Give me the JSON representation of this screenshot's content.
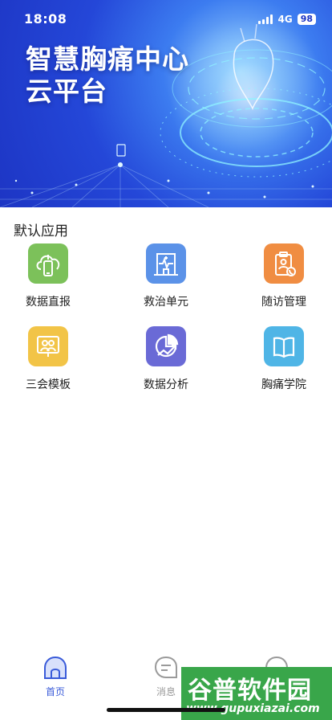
{
  "status_bar": {
    "time": "18:08",
    "network": "4G",
    "battery": "98"
  },
  "hero": {
    "title_line1": "智慧胸痛中心",
    "title_line2": "云平台"
  },
  "section": {
    "title": "默认应用"
  },
  "apps": [
    {
      "label": "数据直报",
      "icon": "cloud-phone-icon",
      "color": "#7cc15a"
    },
    {
      "label": "救治单元",
      "icon": "hospital-heartbeat-icon",
      "color": "#5b92e8"
    },
    {
      "label": "随访管理",
      "icon": "clipboard-phone-icon",
      "color": "#f08d42"
    },
    {
      "label": "三会模板",
      "icon": "meeting-people-icon",
      "color": "#f2c447"
    },
    {
      "label": "数据分析",
      "icon": "analytics-chart-icon",
      "color": "#6a6ad6"
    },
    {
      "label": "胸痛学院",
      "icon": "book-icon",
      "color": "#4fb5e6"
    }
  ],
  "tabbar": {
    "tabs": [
      {
        "label": "首页",
        "icon": "home-icon",
        "active": true
      },
      {
        "label": "消息",
        "icon": "message-icon",
        "active": false
      },
      {
        "label": "",
        "icon": "profile-icon",
        "active": false
      }
    ],
    "active_color": "#3a5bd9",
    "inactive_color": "#9a9a9a"
  },
  "watermark": {
    "name": "谷普软件园",
    "url": "www.gupuxiazai.com"
  }
}
